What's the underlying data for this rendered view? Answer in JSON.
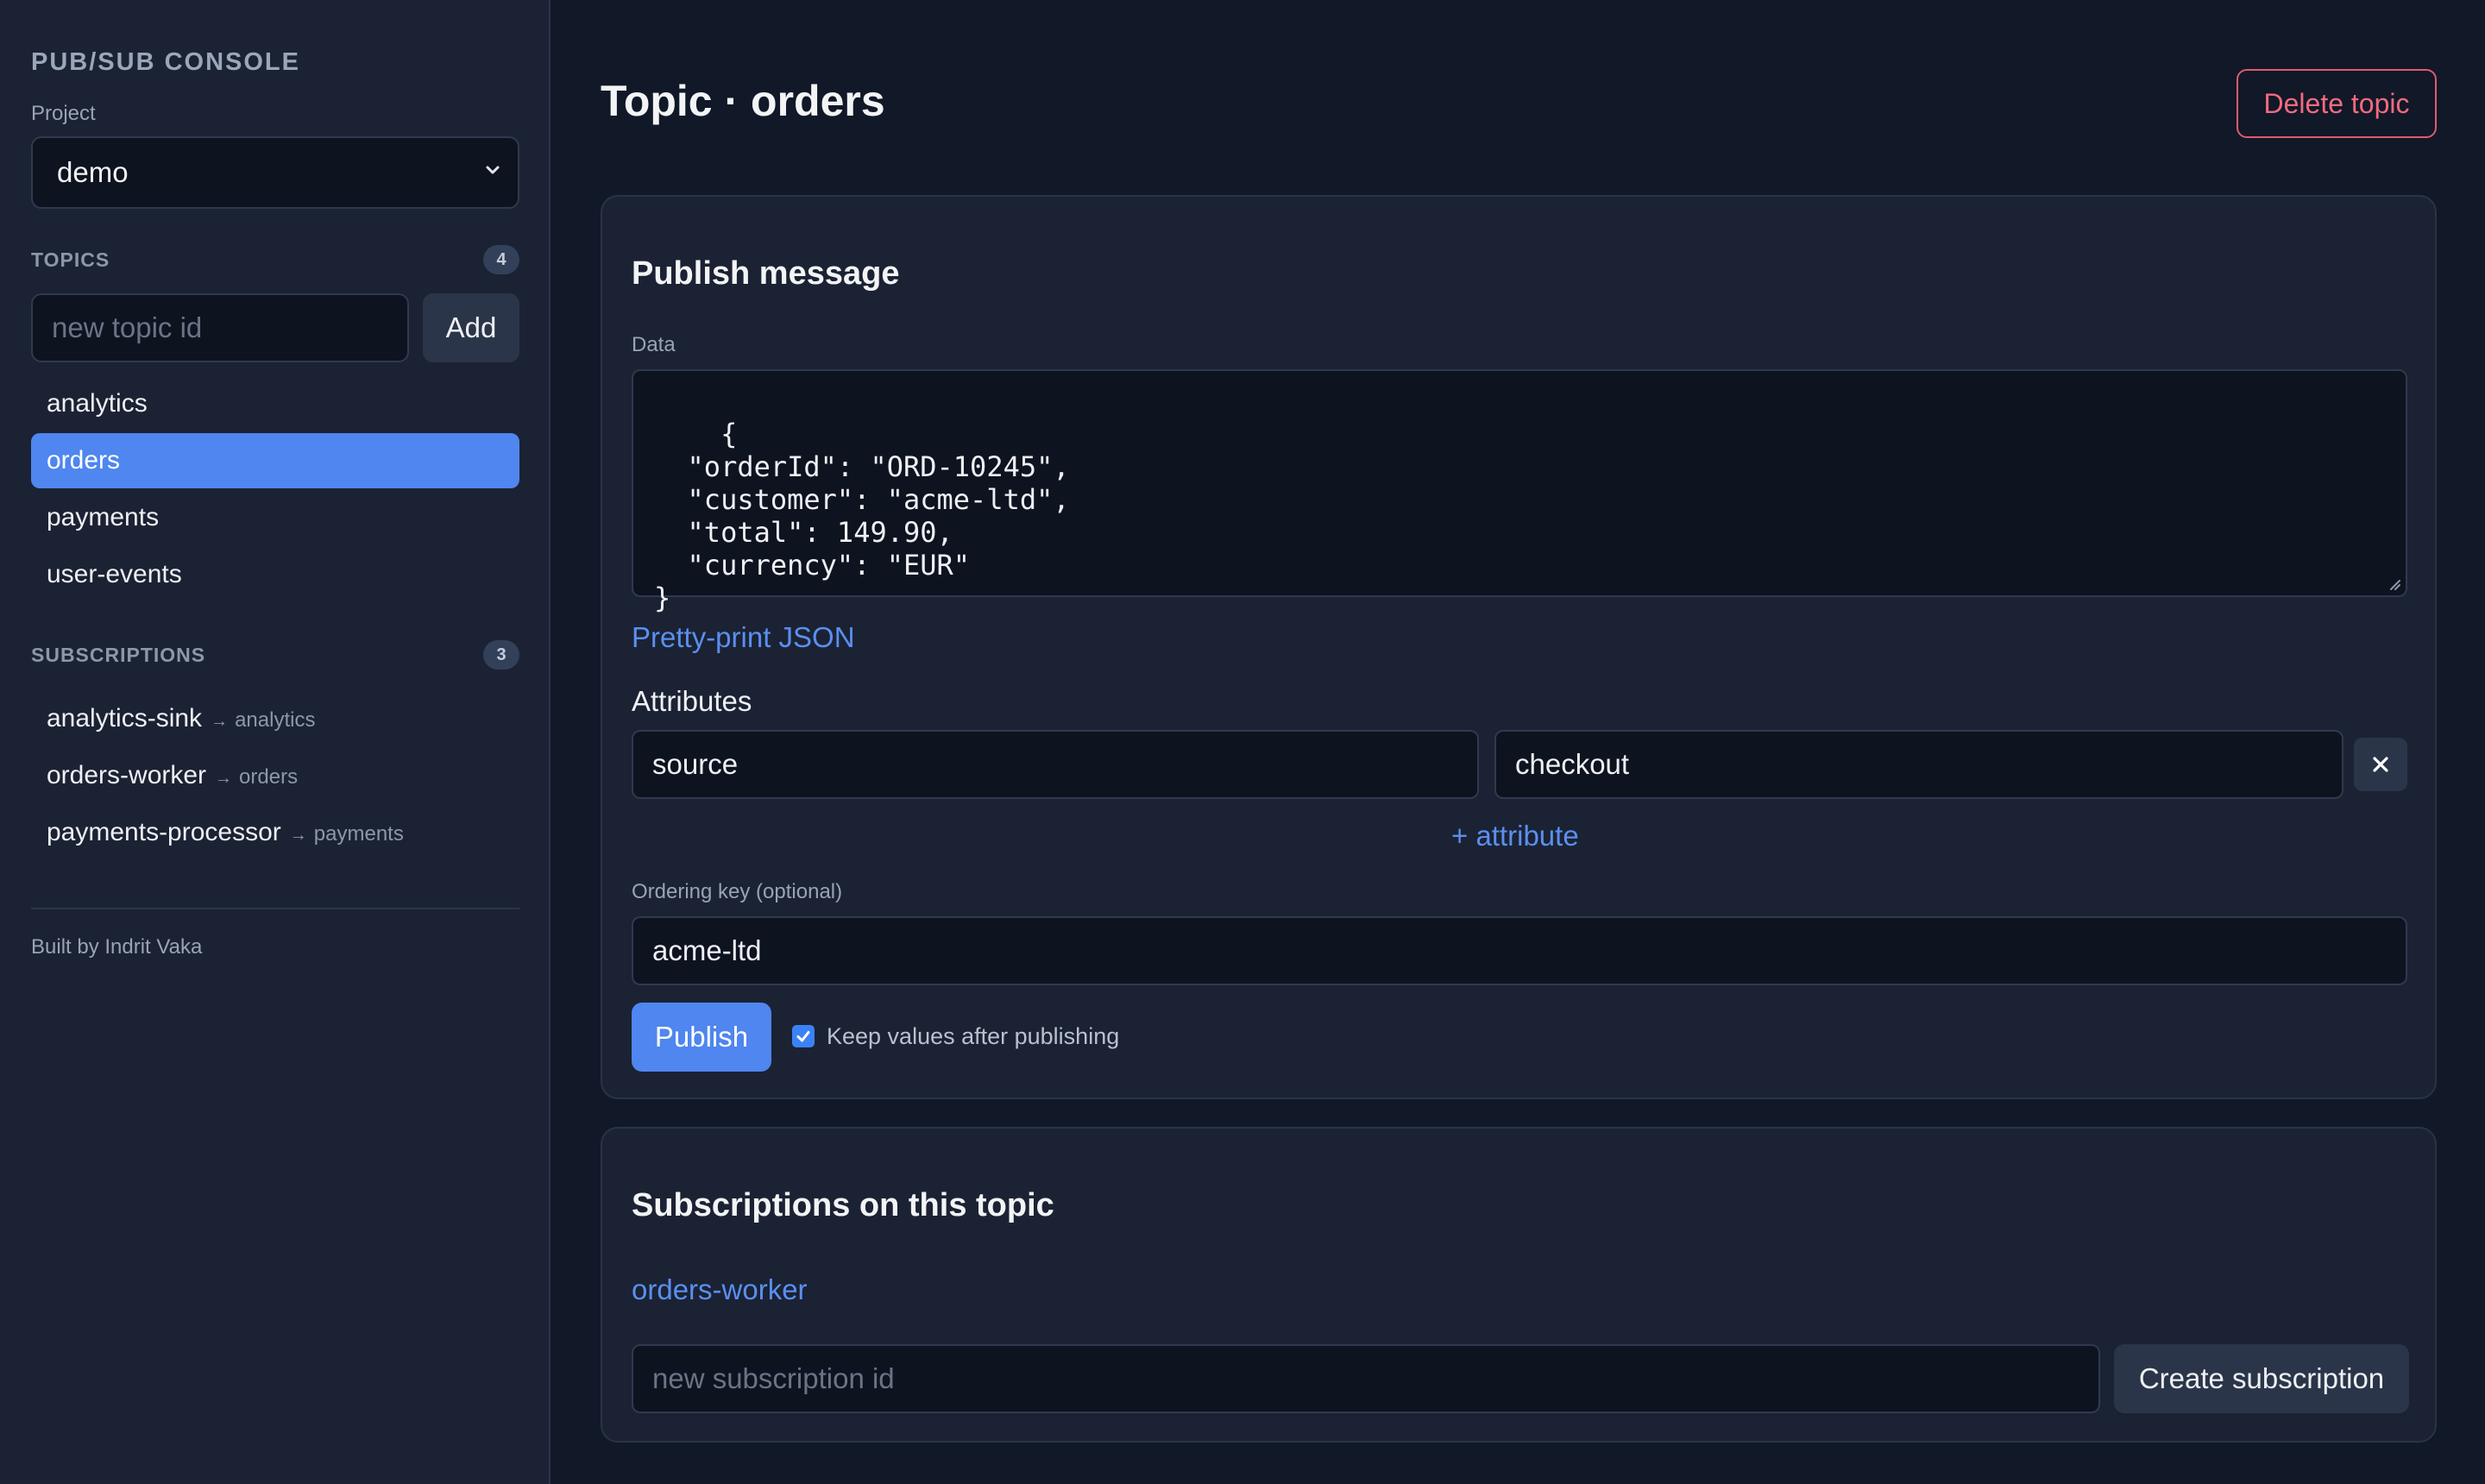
{
  "sidebar": {
    "brand": "PUB/SUB CONSOLE",
    "project_label": "Project",
    "project_value": "demo",
    "topics": {
      "title": "TOPICS",
      "count": "4",
      "new_placeholder": "new topic id",
      "add_label": "Add",
      "items": [
        {
          "label": "analytics"
        },
        {
          "label": "orders"
        },
        {
          "label": "payments"
        },
        {
          "label": "user-events"
        }
      ],
      "active": "orders"
    },
    "subscriptions": {
      "title": "SUBSCRIPTIONS",
      "count": "3",
      "items": [
        {
          "name": "analytics-sink",
          "arrow": "→",
          "topic": "analytics"
        },
        {
          "name": "orders-worker",
          "arrow": "→",
          "topic": "orders"
        },
        {
          "name": "payments-processor",
          "arrow": "→",
          "topic": "payments"
        }
      ]
    },
    "footer": "Built by Indrit Vaka"
  },
  "header": {
    "title": "Topic · orders",
    "delete_label": "Delete topic"
  },
  "publish": {
    "title": "Publish message",
    "data_label": "Data",
    "data_value": "{\n  \"orderId\": \"ORD-10245\",\n  \"customer\": \"acme-ltd\",\n  \"total\": 149.90,\n  \"currency\": \"EUR\"\n}",
    "pretty_print_label": "Pretty-print JSON",
    "attributes_label": "Attributes",
    "attributes": [
      {
        "key": "source",
        "value": "checkout",
        "remove_glyph": "✕"
      }
    ],
    "add_attribute_label": "+ attribute",
    "ordering_key_label": "Ordering key (optional)",
    "ordering_key_value": "acme-ltd",
    "publish_label": "Publish",
    "keep_values_label": "Keep values after publishing",
    "keep_values_checked": true
  },
  "topic_subscriptions": {
    "title": "Subscriptions on this topic",
    "items": [
      {
        "name": "orders-worker"
      }
    ],
    "new_placeholder": "new subscription id",
    "create_label": "Create subscription"
  },
  "colors": {
    "background": "#111827",
    "panel": "#1b2233",
    "accent": "#4f86ef",
    "danger": "#f06b80",
    "link": "#5b8ff0"
  }
}
